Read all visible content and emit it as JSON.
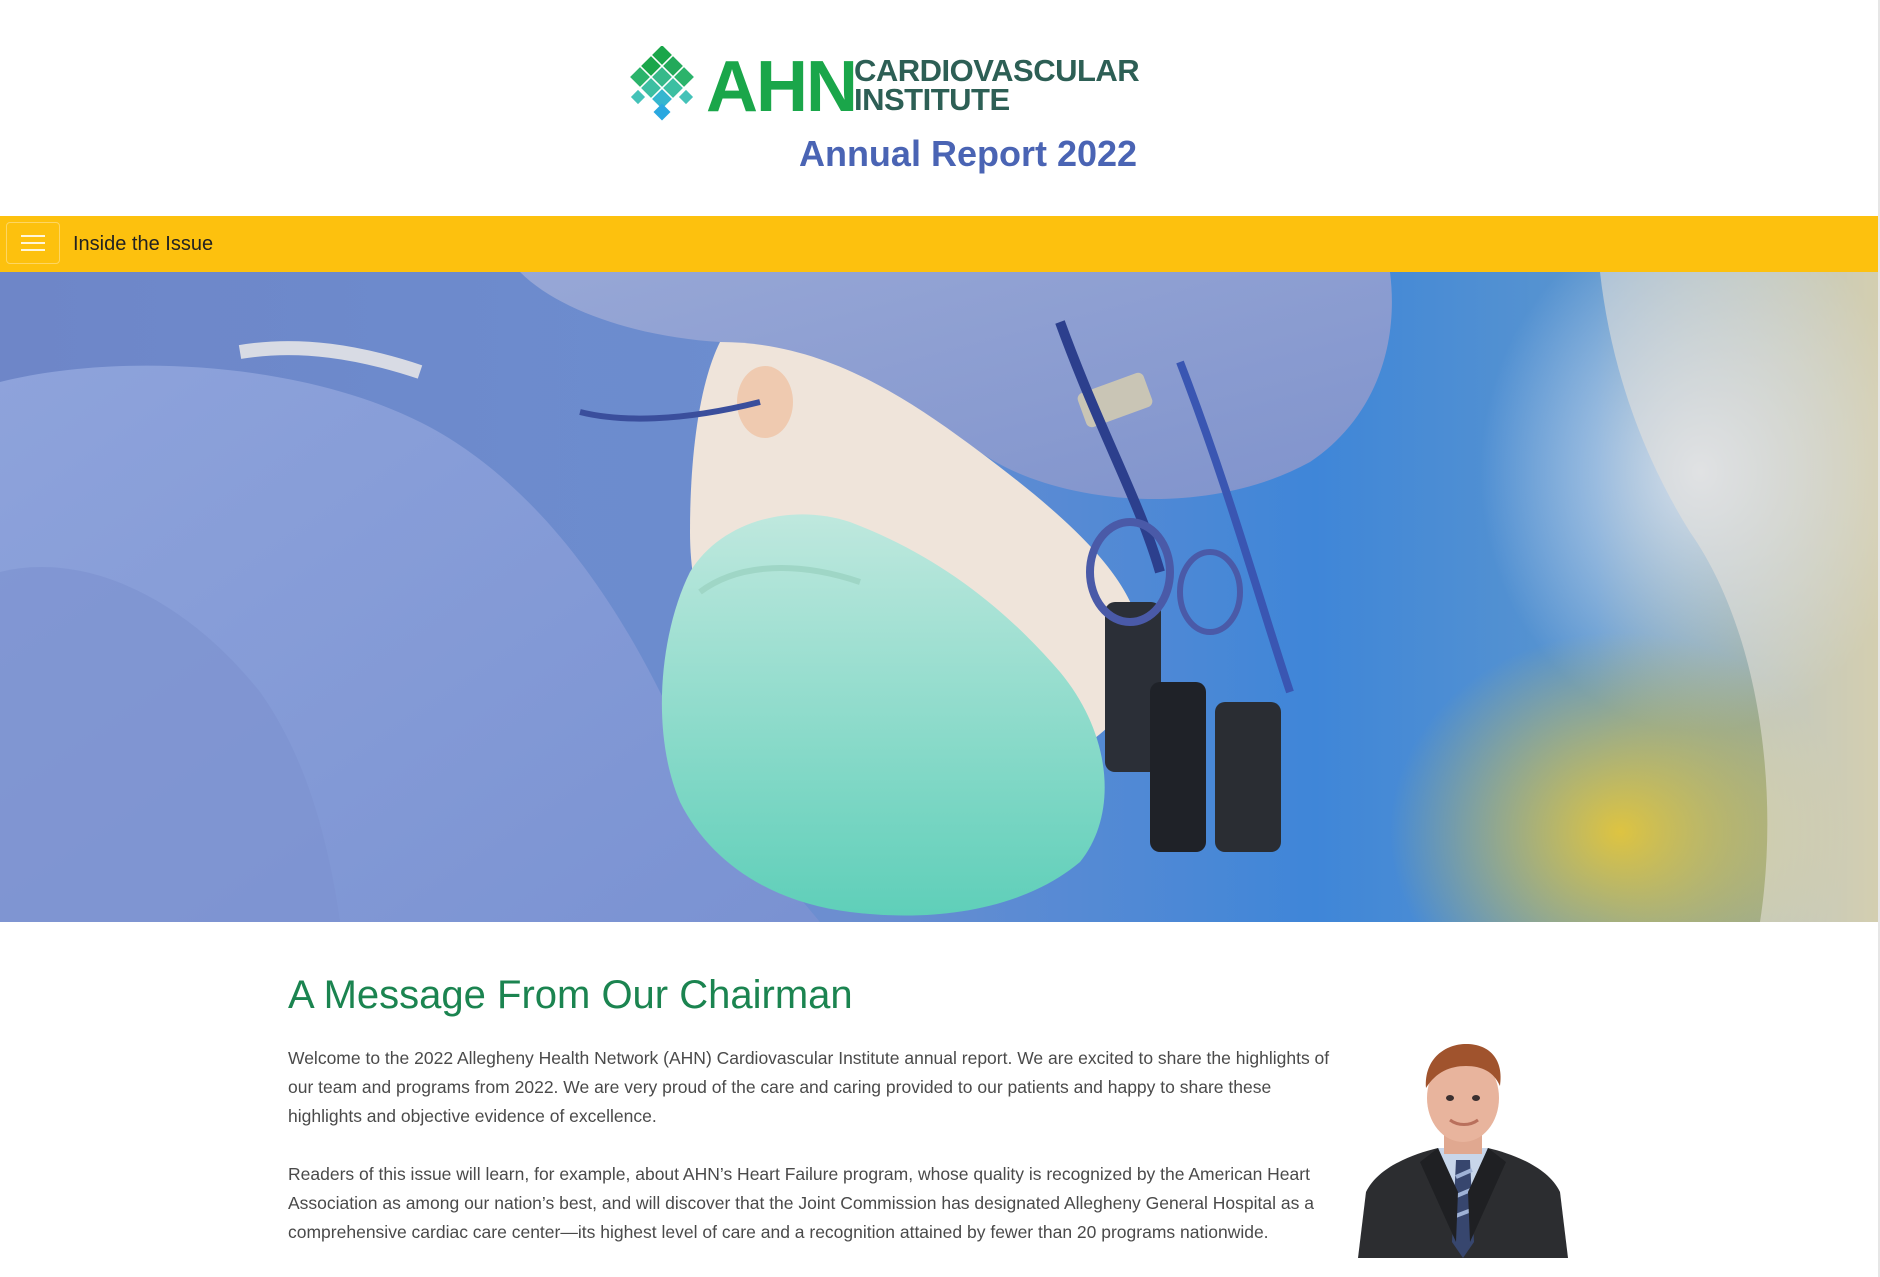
{
  "header": {
    "logo": {
      "wordmark": "AHN",
      "subtitle_line1": "CARDIOVASCULAR",
      "subtitle_line2": "INSTITUTE",
      "icon": "ahn-diamond-logo-icon"
    },
    "report_title": "Annual Report 2022"
  },
  "navbar": {
    "menu_icon": "hamburger-menu-icon",
    "label": "Inside the Issue",
    "background_color": "#fdc10e"
  },
  "hero": {
    "description_icon": "surgeon-hero-image"
  },
  "main": {
    "title": "A Message From Our Chairman",
    "paragraphs": [
      "Welcome to the 2022 Allegheny Health Network (AHN) Cardiovascular Institute annual report. We are excited to share the highlights of our team and programs from 2022. We are very proud of the care and caring provided to our patients and happy to share these highlights and objective evidence of excellence.",
      "Readers of this issue will learn, for example, about AHN’s Heart Failure program, whose quality is recognized by the American Heart Association as among our nation’s best, and will discover that the Joint Commission has designated Allegheny General Hospital as a comprehensive cardiac care center—its highest level of care and a recognition attained by fewer than 20 programs nationwide."
    ],
    "portrait_icon": "chairman-portrait-image"
  },
  "colors": {
    "brand_green": "#1aa64a",
    "dark_teal": "#2d5f55",
    "report_blue": "#4a64b4",
    "heading_green": "#1b8450",
    "nav_yellow": "#fdc10e",
    "body_text": "#4a4a4a"
  }
}
